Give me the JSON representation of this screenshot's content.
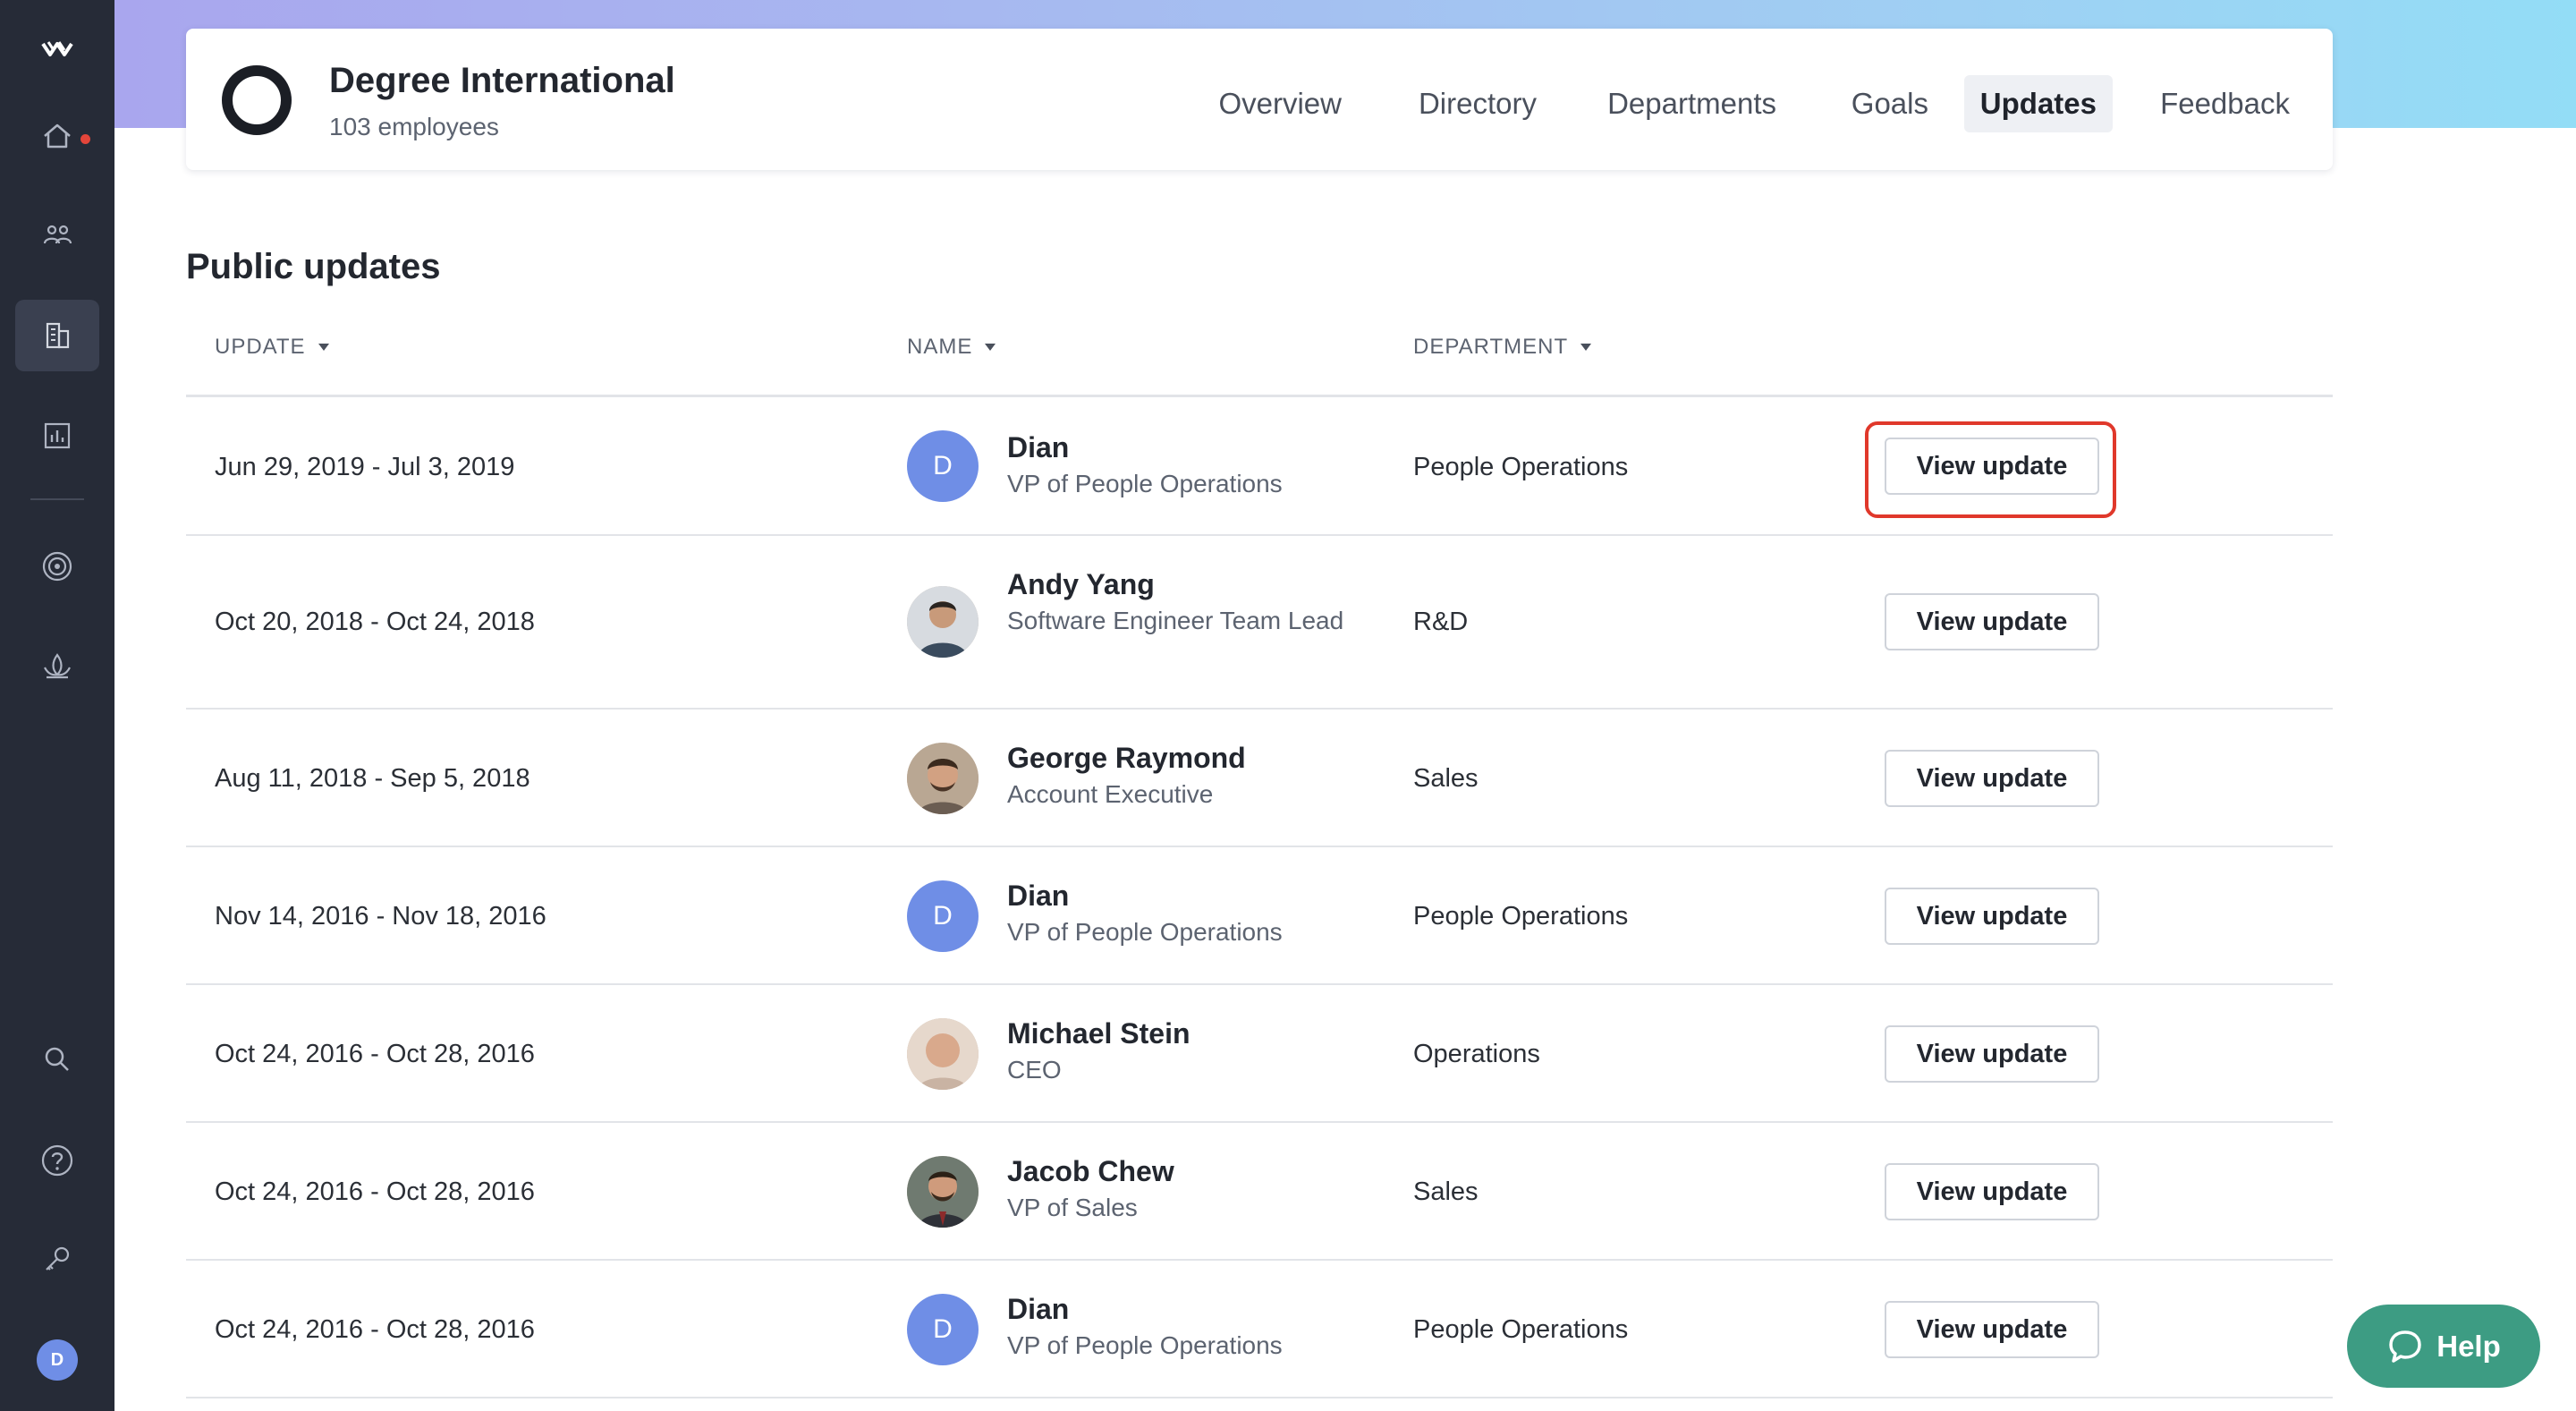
{
  "company": {
    "name": "Degree International",
    "subtitle": "103 employees"
  },
  "nav": {
    "tabs": [
      {
        "label": "Overview"
      },
      {
        "label": "Directory"
      },
      {
        "label": "Departments"
      },
      {
        "label": "Goals"
      },
      {
        "label": "Updates",
        "active": true
      },
      {
        "label": "Feedback"
      }
    ]
  },
  "sidebar": {
    "items": [
      "logo-icon",
      "home-icon",
      "people-icon",
      "building-icon",
      "chart-icon",
      "target-icon",
      "lotus-icon",
      "search-icon",
      "help-circle-icon",
      "key-icon"
    ],
    "avatar_initial": "D",
    "notification_color": "#e3453a"
  },
  "section": {
    "title": "Public updates"
  },
  "table": {
    "headers": {
      "update": "UPDATE",
      "name": "NAME",
      "department": "DEPARTMENT"
    },
    "rows": [
      {
        "date": "Jun 29, 2019 - Jul 3, 2019",
        "name": "Dian",
        "title": "VP of People Operations",
        "department": "People Operations",
        "avatar": "D",
        "button": "View update"
      },
      {
        "date": "Oct 20, 2018 - Oct 24, 2018",
        "name": "Andy Yang",
        "title": "Software Engineer Team Lead",
        "department": "R&D",
        "avatar": "photo",
        "button": "View update"
      },
      {
        "date": "Aug 11, 2018 - Sep 5, 2018",
        "name": "George Raymond",
        "title": "Account Executive",
        "department": "Sales",
        "avatar": "photo",
        "button": "View update"
      },
      {
        "date": "Nov 14, 2016 - Nov 18, 2016",
        "name": "Dian",
        "title": "VP of People Operations",
        "department": "People Operations",
        "avatar": "D",
        "button": "View update"
      },
      {
        "date": "Oct 24, 2016 - Oct 28, 2016",
        "name": "Michael Stein",
        "title": "CEO",
        "department": "Operations",
        "avatar": "photo",
        "button": "View update"
      },
      {
        "date": "Oct 24, 2016 - Oct 28, 2016",
        "name": "Jacob Chew",
        "title": "VP of Sales",
        "department": "Sales",
        "avatar": "photo",
        "button": "View update"
      },
      {
        "date": "Oct 24, 2016 - Oct 28, 2016",
        "name": "Dian",
        "title": "VP of People Operations",
        "department": "People Operations",
        "avatar": "D",
        "button": "View update"
      }
    ]
  },
  "help": {
    "label": "Help",
    "color": "#3d9c83"
  },
  "colors": {
    "sidebar": "#262b37",
    "avatar": "#6f8ee6",
    "highlight": "#e0382b"
  }
}
